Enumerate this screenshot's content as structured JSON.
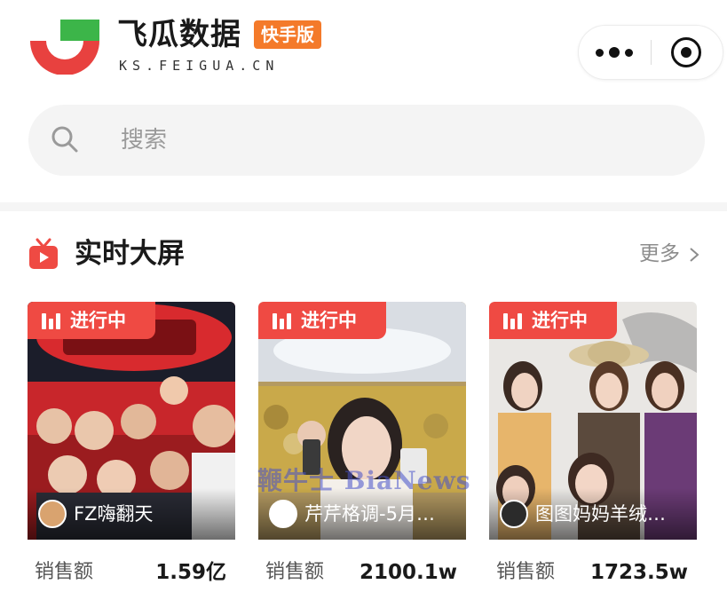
{
  "header": {
    "brand_name": "飞瓜数据",
    "brand_badge": "快手版",
    "brand_domain": "KS.FEIGUA.CN",
    "brand_colors": {
      "red": "#e8413f",
      "green": "#3cb549",
      "orange": "#f47a2a"
    },
    "capsule": {
      "more_icon": "more-dots-icon",
      "close_icon": "target-close-icon"
    }
  },
  "search": {
    "placeholder": "搜索",
    "icon": "search-icon"
  },
  "section": {
    "title": "实时大屏",
    "more_label": "更多",
    "icon": "tv-icon",
    "accent": "#ef4a43"
  },
  "cards": [
    {
      "badge": "进行中",
      "streamer": "FZ嗨翻天",
      "stat_label": "销售额",
      "stat_value": "1.59亿"
    },
    {
      "badge": "进行中",
      "streamer": "芹芹格调-5月…",
      "stat_label": "销售额",
      "stat_value": "2100.1w"
    },
    {
      "badge": "进行中",
      "streamer": "图图妈妈羊绒…",
      "stat_label": "销售额",
      "stat_value": "1723.5w"
    }
  ],
  "watermark": "鞭牛士 BiaNews"
}
